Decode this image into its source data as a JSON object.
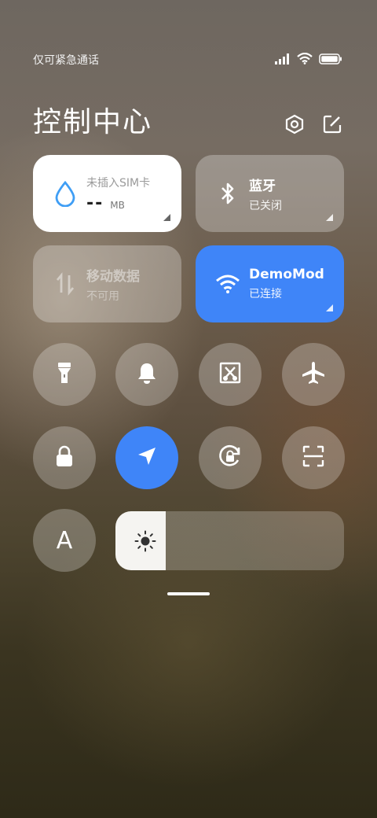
{
  "status_bar": {
    "carrier_text": "仅可紧急通话",
    "icons": [
      "signal-icon",
      "wifi-icon",
      "battery-icon"
    ]
  },
  "header": {
    "title": "控制中心",
    "actions": [
      "settings-icon",
      "edit-icon"
    ]
  },
  "tiles": {
    "data_usage": {
      "label": "未插入SIM卡",
      "value": "--",
      "unit": "MB",
      "icon": "water-drop-icon"
    },
    "bluetooth": {
      "label": "蓝牙",
      "status": "已关闭",
      "icon": "bluetooth-icon"
    },
    "mobile_data": {
      "label": "移动数据",
      "status": "不可用",
      "icon": "data-arrows-icon"
    },
    "wifi": {
      "label": "DemoMod",
      "status": "已连接",
      "icon": "wifi-icon"
    }
  },
  "toggles": [
    {
      "name": "flashlight",
      "icon": "flashlight-icon",
      "active": false
    },
    {
      "name": "silent",
      "icon": "bell-icon",
      "active": false
    },
    {
      "name": "screenshot",
      "icon": "screenshot-scissors-icon",
      "active": false
    },
    {
      "name": "airplane",
      "icon": "airplane-icon",
      "active": false
    },
    {
      "name": "lock",
      "icon": "lock-icon",
      "active": false
    },
    {
      "name": "location",
      "icon": "location-arrow-icon",
      "active": true
    },
    {
      "name": "rotation-lock",
      "icon": "rotation-lock-icon",
      "active": false
    },
    {
      "name": "scanner",
      "icon": "scan-icon",
      "active": false
    },
    {
      "name": "auto-brightness",
      "icon": "auto-brightness-icon",
      "label": "A",
      "active": false
    }
  ],
  "brightness": {
    "level": 0.22,
    "icon": "sun-icon"
  },
  "colors": {
    "accent": "#3f85f8",
    "tile_active_white": "#ffffff"
  }
}
